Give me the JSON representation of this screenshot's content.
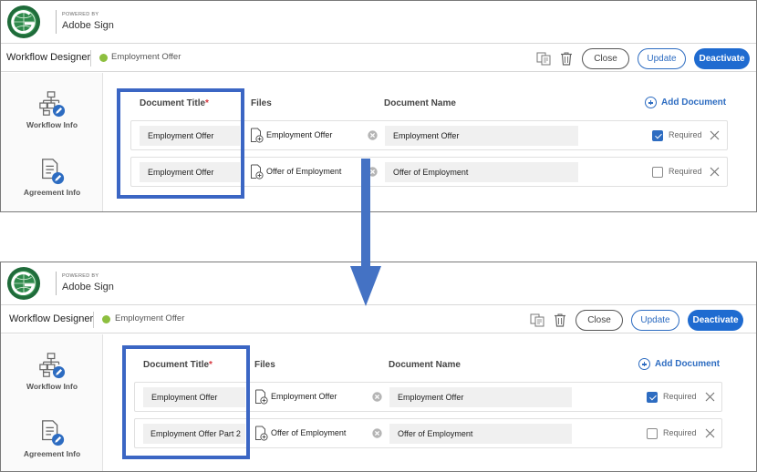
{
  "brand": {
    "powered_by": "POWERED BY",
    "product": "Adobe Sign"
  },
  "colors": {
    "accent": "#2d6cc1",
    "deactivate_bg": "#1f6bd0",
    "status_dot": "#8dbf3f",
    "highlight_border": "#3b66c4",
    "required_star": "#d7373f"
  },
  "icons": {
    "logo": "globe-logo-icon",
    "copy": "copy-icon",
    "delete": "trash-icon",
    "workflow_info": "workflow-edit-icon",
    "agreement_info": "agreement-edit-icon",
    "file": "file-add-icon",
    "clear": "clear-circle-icon",
    "remove": "x-icon",
    "add": "plus-circle-icon",
    "arrow": "down-arrow-icon"
  },
  "top": {
    "toolbar": {
      "title": "Workflow Designer",
      "workflow_name": "Employment Offer",
      "close_label": "Close",
      "update_label": "Update",
      "deactivate_label": "Deactivate"
    },
    "sidebar": {
      "items": [
        {
          "label": "Workflow Info"
        },
        {
          "label": "Agreement Info"
        }
      ]
    },
    "table": {
      "col_title": "Document Title",
      "col_title_required": "*",
      "col_files": "Files",
      "col_docname": "Document Name",
      "add_document": "Add Document",
      "required_label": "Required",
      "rows": [
        {
          "title": "Employment Offer",
          "file": "Employment Offer",
          "doc_name": "Employment Offer",
          "required": true
        },
        {
          "title": "Employment Offer",
          "file": "Offer of Employment",
          "doc_name": "Offer of Employment",
          "required": false
        }
      ]
    }
  },
  "bottom": {
    "toolbar": {
      "title": "Workflow Designer",
      "workflow_name": "Employment Offer",
      "close_label": "Close",
      "update_label": "Update",
      "deactivate_label": "Deactivate"
    },
    "sidebar": {
      "items": [
        {
          "label": "Workflow Info"
        },
        {
          "label": "Agreement Info"
        }
      ]
    },
    "table": {
      "col_title": "Document Title",
      "col_title_required": "*",
      "col_files": "Files",
      "col_docname": "Document Name",
      "add_document": "Add Document",
      "required_label": "Required",
      "rows": [
        {
          "title": "Employment Offer",
          "file": "Employment Offer",
          "doc_name": "Employment Offer",
          "required": true
        },
        {
          "title": "Employment Offer Part 2",
          "file": "Offer of Employment",
          "doc_name": "Offer of Employment",
          "required": false
        }
      ]
    }
  }
}
